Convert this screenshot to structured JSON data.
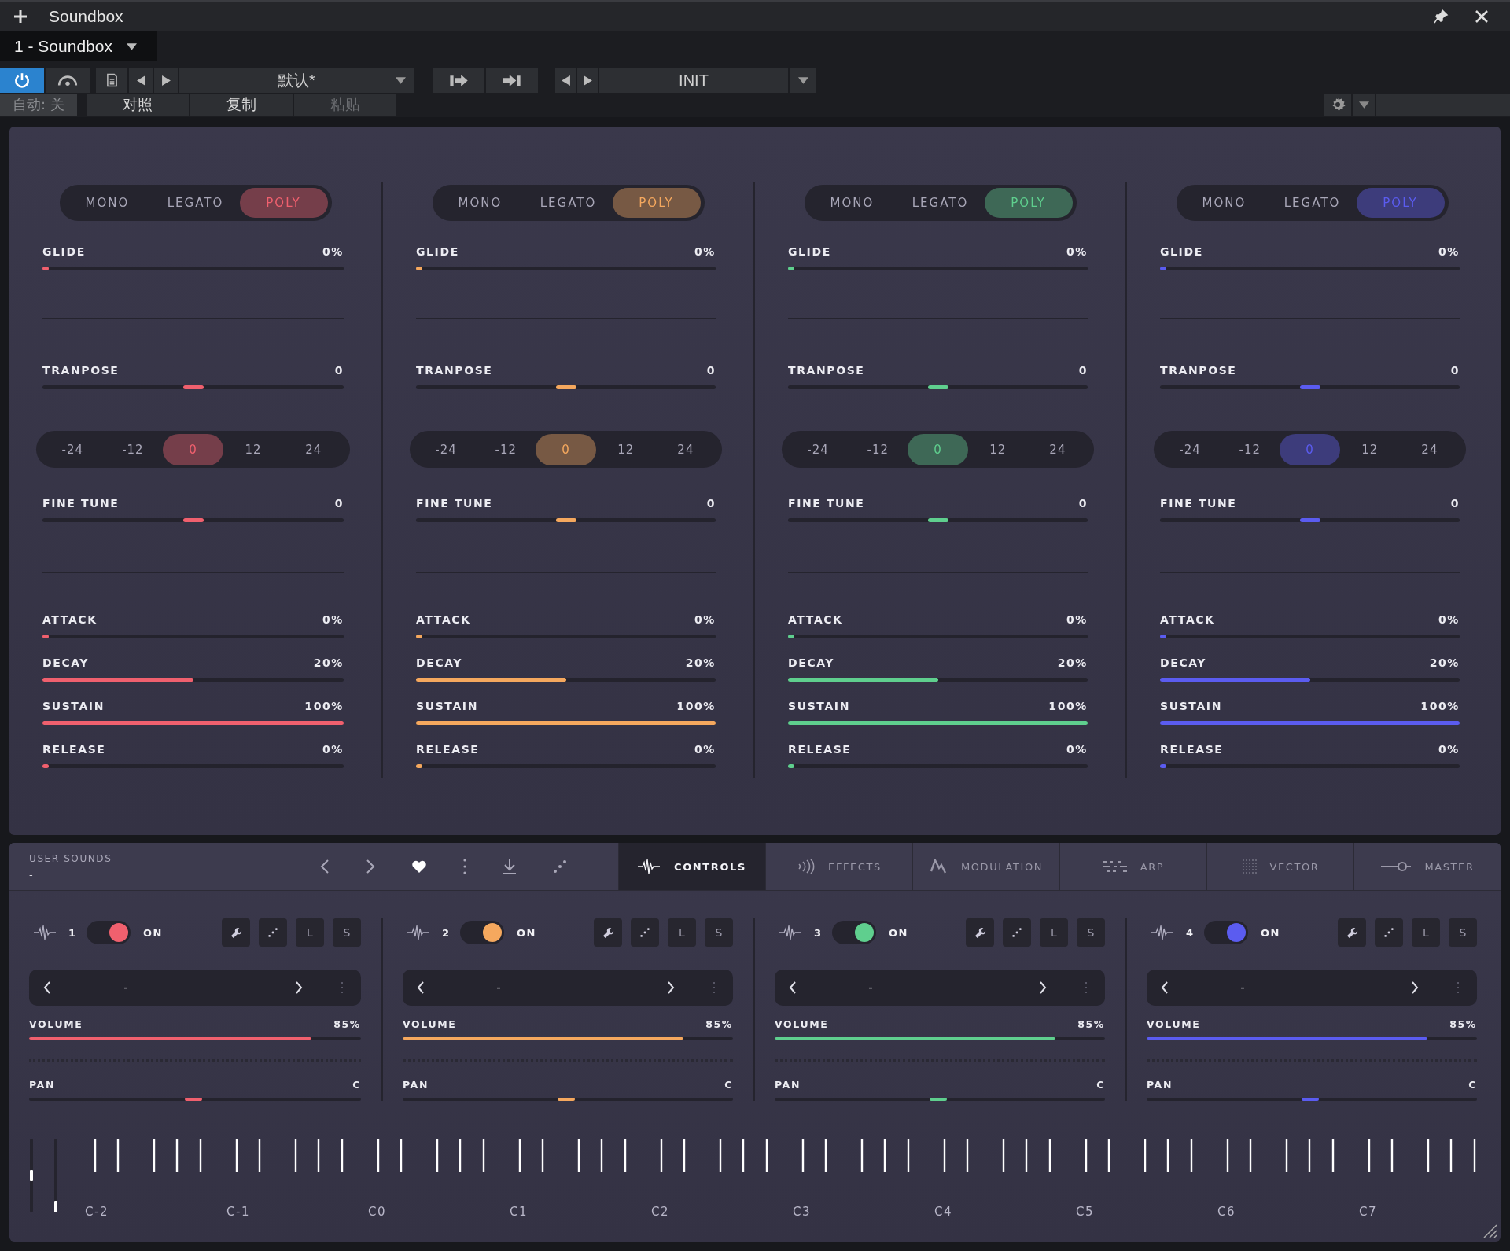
{
  "window": {
    "title": "Soundbox",
    "tab": "1 - Soundbox"
  },
  "toolbar": {
    "power_on": true,
    "preset": "默认*",
    "patch": "INIT",
    "auto": "自动: 关",
    "actions": [
      {
        "label": "对照",
        "disabled": false
      },
      {
        "label": "复制",
        "disabled": false
      },
      {
        "label": "粘贴",
        "disabled": true
      }
    ]
  },
  "voices": [
    {
      "color": "#f0606e",
      "modes": [
        {
          "label": "MONO",
          "selected": false
        },
        {
          "label": "LEGATO",
          "selected": false
        },
        {
          "label": "POLY",
          "selected": true
        }
      ],
      "glide": {
        "kind": "fill",
        "label": "GLIDE",
        "value": "0%",
        "level": 0
      },
      "transpose": {
        "kind": "thumb",
        "label": "TRANPOSE",
        "value": "0",
        "level": 0.5
      },
      "octaves": [
        {
          "label": "-24",
          "selected": false
        },
        {
          "label": "-12",
          "selected": false
        },
        {
          "label": "0",
          "selected": true
        },
        {
          "label": "12",
          "selected": false
        },
        {
          "label": "24",
          "selected": false
        }
      ],
      "fine_tune": {
        "kind": "thumb",
        "label": "FINE TUNE",
        "value": "0",
        "level": 0.5
      },
      "envelope": [
        {
          "kind": "fill",
          "label": "ATTACK",
          "value": "0%",
          "level": 0
        },
        {
          "kind": "fill",
          "label": "DECAY",
          "value": "20%",
          "level": 0.5
        },
        {
          "kind": "fill",
          "label": "SUSTAIN",
          "value": "100%",
          "level": 1
        },
        {
          "kind": "fill",
          "label": "RELEASE",
          "value": "0%",
          "level": 0
        }
      ]
    },
    {
      "color": "#f5a85e",
      "modes": [
        {
          "label": "MONO",
          "selected": false
        },
        {
          "label": "LEGATO",
          "selected": false
        },
        {
          "label": "POLY",
          "selected": true
        }
      ],
      "glide": {
        "kind": "fill",
        "label": "GLIDE",
        "value": "0%",
        "level": 0
      },
      "transpose": {
        "kind": "thumb",
        "label": "TRANPOSE",
        "value": "0",
        "level": 0.5
      },
      "octaves": [
        {
          "label": "-24",
          "selected": false
        },
        {
          "label": "-12",
          "selected": false
        },
        {
          "label": "0",
          "selected": true
        },
        {
          "label": "12",
          "selected": false
        },
        {
          "label": "24",
          "selected": false
        }
      ],
      "fine_tune": {
        "kind": "thumb",
        "label": "FINE TUNE",
        "value": "0",
        "level": 0.5
      },
      "envelope": [
        {
          "kind": "fill",
          "label": "ATTACK",
          "value": "0%",
          "level": 0
        },
        {
          "kind": "fill",
          "label": "DECAY",
          "value": "20%",
          "level": 0.5
        },
        {
          "kind": "fill",
          "label": "SUSTAIN",
          "value": "100%",
          "level": 1
        },
        {
          "kind": "fill",
          "label": "RELEASE",
          "value": "0%",
          "level": 0
        }
      ]
    },
    {
      "color": "#5fcf8e",
      "modes": [
        {
          "label": "MONO",
          "selected": false
        },
        {
          "label": "LEGATO",
          "selected": false
        },
        {
          "label": "POLY",
          "selected": true
        }
      ],
      "glide": {
        "kind": "fill",
        "label": "GLIDE",
        "value": "0%",
        "level": 0
      },
      "transpose": {
        "kind": "thumb",
        "label": "TRANPOSE",
        "value": "0",
        "level": 0.5
      },
      "octaves": [
        {
          "label": "-24",
          "selected": false
        },
        {
          "label": "-12",
          "selected": false
        },
        {
          "label": "0",
          "selected": true
        },
        {
          "label": "12",
          "selected": false
        },
        {
          "label": "24",
          "selected": false
        }
      ],
      "fine_tune": {
        "kind": "thumb",
        "label": "FINE TUNE",
        "value": "0",
        "level": 0.5
      },
      "envelope": [
        {
          "kind": "fill",
          "label": "ATTACK",
          "value": "0%",
          "level": 0
        },
        {
          "kind": "fill",
          "label": "DECAY",
          "value": "20%",
          "level": 0.5
        },
        {
          "kind": "fill",
          "label": "SUSTAIN",
          "value": "100%",
          "level": 1
        },
        {
          "kind": "fill",
          "label": "RELEASE",
          "value": "0%",
          "level": 0
        }
      ]
    },
    {
      "color": "#5b5cf0",
      "modes": [
        {
          "label": "MONO",
          "selected": false
        },
        {
          "label": "LEGATO",
          "selected": false
        },
        {
          "label": "POLY",
          "selected": true
        }
      ],
      "glide": {
        "kind": "fill",
        "label": "GLIDE",
        "value": "0%",
        "level": 0
      },
      "transpose": {
        "kind": "thumb",
        "label": "TRANPOSE",
        "value": "0",
        "level": 0.5
      },
      "octaves": [
        {
          "label": "-24",
          "selected": false
        },
        {
          "label": "-12",
          "selected": false
        },
        {
          "label": "0",
          "selected": true
        },
        {
          "label": "12",
          "selected": false
        },
        {
          "label": "24",
          "selected": false
        }
      ],
      "fine_tune": {
        "kind": "thumb",
        "label": "FINE TUNE",
        "value": "0",
        "level": 0.5
      },
      "envelope": [
        {
          "kind": "fill",
          "label": "ATTACK",
          "value": "0%",
          "level": 0
        },
        {
          "kind": "fill",
          "label": "DECAY",
          "value": "20%",
          "level": 0.5
        },
        {
          "kind": "fill",
          "label": "SUSTAIN",
          "value": "100%",
          "level": 1
        },
        {
          "kind": "fill",
          "label": "RELEASE",
          "value": "0%",
          "level": 0
        }
      ]
    }
  ],
  "browser": {
    "title": "USER SOUNDS",
    "current": "-"
  },
  "tabs": [
    {
      "label": "CONTROLS",
      "selected": true
    },
    {
      "label": "EFFECTS",
      "selected": false
    },
    {
      "label": "MODULATION",
      "selected": false
    },
    {
      "label": "ARP",
      "selected": false
    },
    {
      "label": "VECTOR",
      "selected": false
    },
    {
      "label": "MASTER",
      "selected": false
    }
  ],
  "channels": [
    {
      "number": "1",
      "color": "#f0606e",
      "on": true,
      "state": "ON",
      "buttons": [
        "L",
        "S"
      ],
      "preset": "-",
      "volume": {
        "kind": "fill",
        "label": "VOLUME",
        "value": "85%",
        "level": 0.85
      },
      "pan": {
        "kind": "thumb",
        "label": "PAN",
        "value": "C",
        "level": 0.5
      }
    },
    {
      "number": "2",
      "color": "#f5a85e",
      "on": true,
      "state": "ON",
      "buttons": [
        "L",
        "S"
      ],
      "preset": "-",
      "volume": {
        "kind": "fill",
        "label": "VOLUME",
        "value": "85%",
        "level": 0.85
      },
      "pan": {
        "kind": "thumb",
        "label": "PAN",
        "value": "C",
        "level": 0.5
      }
    },
    {
      "number": "3",
      "color": "#5fcf8e",
      "on": true,
      "state": "ON",
      "buttons": [
        "L",
        "S"
      ],
      "preset": "-",
      "volume": {
        "kind": "fill",
        "label": "VOLUME",
        "value": "85%",
        "level": 0.85
      },
      "pan": {
        "kind": "thumb",
        "label": "PAN",
        "value": "C",
        "level": 0.5
      }
    },
    {
      "number": "4",
      "color": "#5b5cf0",
      "on": true,
      "state": "ON",
      "buttons": [
        "L",
        "S"
      ],
      "preset": "-",
      "volume": {
        "kind": "fill",
        "label": "VOLUME",
        "value": "85%",
        "level": 0.85
      },
      "pan": {
        "kind": "thumb",
        "label": "PAN",
        "value": "C",
        "level": 0.5
      }
    }
  ],
  "keyboard": {
    "wheels": [
      {
        "level": 0.5
      },
      {
        "level": 0
      }
    ],
    "octave_labels": [
      "C-2",
      "C-1",
      "C0",
      "C1",
      "C2",
      "C3",
      "C4",
      "C5",
      "C6",
      "C7"
    ]
  }
}
